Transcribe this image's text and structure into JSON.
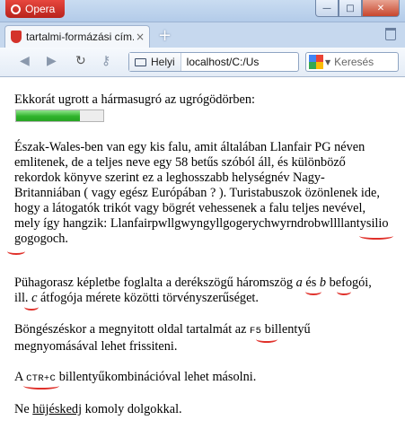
{
  "browser": {
    "app_button": "Opera",
    "tab_title": "tartalmi-formázási cím...",
    "new_tab": "+",
    "site_label": "Helyi",
    "address": "localhost/C:/Us",
    "search_placeholder": "Keresés",
    "window_controls": {
      "minimize": "—",
      "maximize": "□",
      "close": "✕"
    },
    "nav_icons": {
      "back": "◀",
      "forward": "▶",
      "reload": "↻",
      "key": "⚷"
    },
    "brand_color": "#d4322a"
  },
  "page": {
    "p1": "Ekkorát ugrott a hármasugró az ugrógödörben:",
    "progress_value": 0.73,
    "p2": {
      "line1": "Észak-Wales-ben van egy kis falu, amit általában Llanfair PG néven",
      "line2": "emlitenek, de a teljes neve egy 58 betűs szóból áll, és különböző",
      "line3": "rekordok könyve szerint ez a leghosszabb helységnév Nagy-",
      "line4": "Britanniában ( vagy egész Európában ? ). Turistabuszok özönlenek ide,",
      "line5": "hogy a látogatók trikót vagy bögrét vehessenek a falu teljes nevével,",
      "line6_prefix": "mely így hangzik: ",
      "line6_word": "Llanfairpwllgwyngyllgogerychwyrndrobwllllantysilio",
      "line7_word": "gogogoch",
      "line7_suffix": "."
    },
    "p3": {
      "pre": "Pühagorasz képletbe foglalta a derékszögű háromszög ",
      "var_a": "a",
      "mid": " és ",
      "var_b": "b",
      "post": " befogói,",
      "line2_pre": "ill. ",
      "var_c": "c",
      "line2_post": " átfogója mérete közötti törvényszerűséget."
    },
    "p4": {
      "pre": "Böngészéskor a megnyitott oldal tartalmát az ",
      "key": "F5",
      "post": " billentyű",
      "line2": "megnyomásával lehet frissiteni."
    },
    "p5": {
      "pre": "A ",
      "key": "CTR+C",
      "post": " billentyűkombinációval lehet másolni."
    },
    "p6": {
      "pre": "Ne ",
      "word": "hüjéskedj",
      "post": " komoly dolgokkal."
    },
    "marker_color": "#e0302a"
  }
}
